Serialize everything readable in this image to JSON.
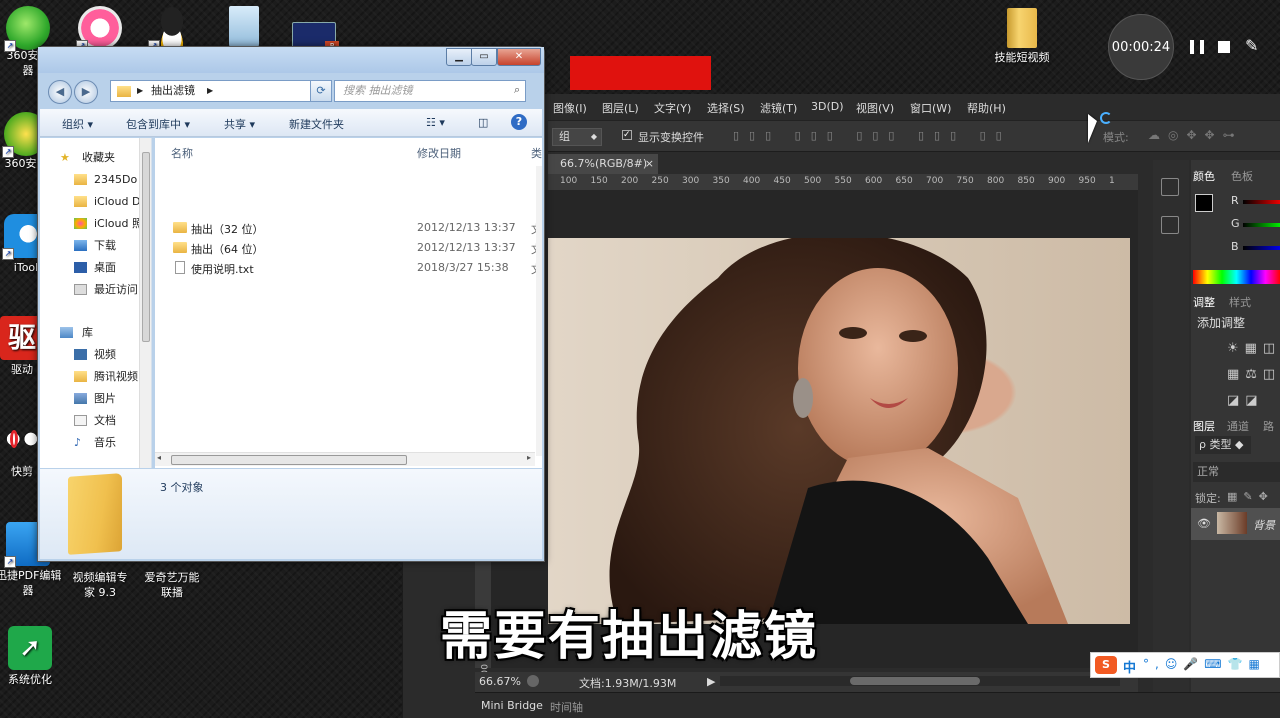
{
  "desktop": {
    "icons": [
      {
        "label": "360安全\n器",
        "name": "360-browser"
      },
      {
        "label": "",
        "name": "itunes"
      },
      {
        "label": "",
        "name": "qq"
      },
      {
        "label": "",
        "name": "recycle-bin"
      },
      {
        "label": "",
        "name": "ppt-file"
      },
      {
        "label": "360安全",
        "name": "360-security"
      },
      {
        "label": "iTool",
        "name": "itools"
      },
      {
        "label": "驱动",
        "name": "driver-app"
      },
      {
        "label": "快剪",
        "name": "quick-cut"
      },
      {
        "label": "迅捷PDF编辑\n器",
        "name": "pdf-editor"
      },
      {
        "label": "视频编辑专\n家 9.3",
        "name": "video-editor"
      },
      {
        "label": "爱奇艺万能\n联播",
        "name": "iqiyi"
      },
      {
        "label": "系统优化",
        "name": "system-optimizer"
      },
      {
        "label": "技能短视频",
        "name": "skill-video-folder"
      }
    ]
  },
  "recorder": {
    "time": "00:00:24"
  },
  "explorer": {
    "address": "抽出滤镜",
    "search_placeholder": "搜索 抽出滤镜",
    "toolbar": {
      "organize": "组织",
      "include": "包含到库中",
      "share": "共享",
      "new_folder": "新建文件夹"
    },
    "nav": {
      "favorites": "收藏夹",
      "fav_items": [
        "2345Do",
        "iCloud D",
        "iCloud 照",
        "下载",
        "桌面",
        "最近访问"
      ],
      "library": "库",
      "lib_items": [
        "视频",
        "腾讯视频",
        "图片",
        "文档",
        "音乐"
      ]
    },
    "columns": {
      "name": "名称",
      "date": "修改日期",
      "type": "类"
    },
    "files": [
      {
        "name": "抽出（32 位）",
        "date": "2012/12/13 13:37",
        "type": "文",
        "kind": "folder"
      },
      {
        "name": "抽出（64 位）",
        "date": "2012/12/13 13:37",
        "type": "文",
        "kind": "folder"
      },
      {
        "name": "使用说明.txt",
        "date": "2018/3/27 15:38",
        "type": "文",
        "kind": "txt"
      }
    ],
    "count": "3 个对象"
  },
  "photoshop": {
    "menu": [
      "图像(I)",
      "图层(L)",
      "文字(Y)",
      "选择(S)",
      "滤镜(T)",
      "3D(D)",
      "视图(V)",
      "窗口(W)",
      "帮助(H)"
    ],
    "options": {
      "group": "组",
      "show_transform": "显示变换控件",
      "mode": "模式:"
    },
    "doc_tab": "66.7%(RGB/8#)",
    "ruler_ticks": [
      "100",
      "150",
      "200",
      "250",
      "300",
      "350",
      "400",
      "450",
      "500",
      "550",
      "600",
      "650",
      "700",
      "750",
      "800",
      "850",
      "900",
      "950",
      "1"
    ],
    "status": {
      "zoom": "66.67%",
      "doc": "文档:1.93M/1.93M"
    },
    "bottom_tabs": [
      "Mini Bridge",
      "时间轴"
    ],
    "panels": {
      "color_tab": "颜色",
      "swatches_tab": "色板",
      "channels": [
        "R",
        "G",
        "B"
      ],
      "adjust_tab": "调整",
      "styles_tab": "样式",
      "add_adjust": "添加调整",
      "layers_tab": "图层",
      "channels_tab": "通道",
      "paths_tab": "路",
      "kind": "ρ 类型",
      "blend": "正常",
      "lock": "锁定:",
      "layer_name": "背景"
    }
  },
  "subtitle": "需要有抽出滤镜",
  "ime": {
    "lang": "中"
  }
}
